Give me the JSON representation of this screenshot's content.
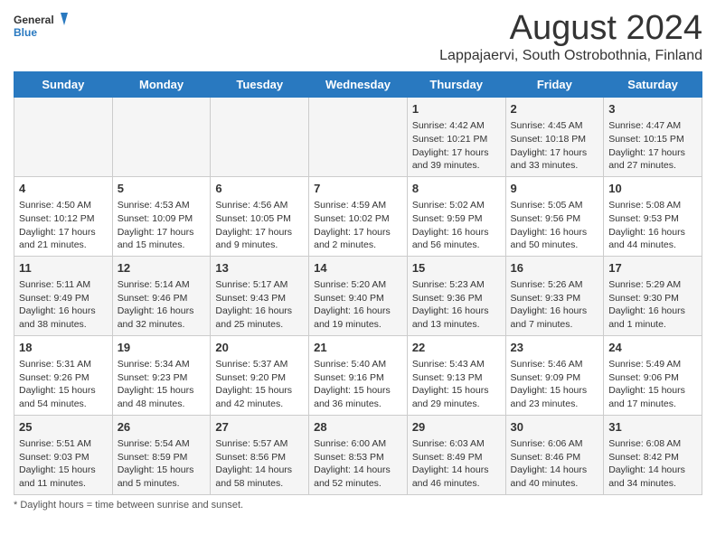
{
  "header": {
    "logo_line1": "General",
    "logo_line2": "Blue",
    "main_title": "August 2024",
    "subtitle": "Lappajaervi, South Ostrobothnia, Finland"
  },
  "footer": {
    "note": "Daylight hours"
  },
  "columns": [
    "Sunday",
    "Monday",
    "Tuesday",
    "Wednesday",
    "Thursday",
    "Friday",
    "Saturday"
  ],
  "weeks": [
    [
      {
        "day": "",
        "info": ""
      },
      {
        "day": "",
        "info": ""
      },
      {
        "day": "",
        "info": ""
      },
      {
        "day": "",
        "info": ""
      },
      {
        "day": "1",
        "info": "Sunrise: 4:42 AM\nSunset: 10:21 PM\nDaylight: 17 hours\nand 39 minutes."
      },
      {
        "day": "2",
        "info": "Sunrise: 4:45 AM\nSunset: 10:18 PM\nDaylight: 17 hours\nand 33 minutes."
      },
      {
        "day": "3",
        "info": "Sunrise: 4:47 AM\nSunset: 10:15 PM\nDaylight: 17 hours\nand 27 minutes."
      }
    ],
    [
      {
        "day": "4",
        "info": "Sunrise: 4:50 AM\nSunset: 10:12 PM\nDaylight: 17 hours\nand 21 minutes."
      },
      {
        "day": "5",
        "info": "Sunrise: 4:53 AM\nSunset: 10:09 PM\nDaylight: 17 hours\nand 15 minutes."
      },
      {
        "day": "6",
        "info": "Sunrise: 4:56 AM\nSunset: 10:05 PM\nDaylight: 17 hours\nand 9 minutes."
      },
      {
        "day": "7",
        "info": "Sunrise: 4:59 AM\nSunset: 10:02 PM\nDaylight: 17 hours\nand 2 minutes."
      },
      {
        "day": "8",
        "info": "Sunrise: 5:02 AM\nSunset: 9:59 PM\nDaylight: 16 hours\nand 56 minutes."
      },
      {
        "day": "9",
        "info": "Sunrise: 5:05 AM\nSunset: 9:56 PM\nDaylight: 16 hours\nand 50 minutes."
      },
      {
        "day": "10",
        "info": "Sunrise: 5:08 AM\nSunset: 9:53 PM\nDaylight: 16 hours\nand 44 minutes."
      }
    ],
    [
      {
        "day": "11",
        "info": "Sunrise: 5:11 AM\nSunset: 9:49 PM\nDaylight: 16 hours\nand 38 minutes."
      },
      {
        "day": "12",
        "info": "Sunrise: 5:14 AM\nSunset: 9:46 PM\nDaylight: 16 hours\nand 32 minutes."
      },
      {
        "day": "13",
        "info": "Sunrise: 5:17 AM\nSunset: 9:43 PM\nDaylight: 16 hours\nand 25 minutes."
      },
      {
        "day": "14",
        "info": "Sunrise: 5:20 AM\nSunset: 9:40 PM\nDaylight: 16 hours\nand 19 minutes."
      },
      {
        "day": "15",
        "info": "Sunrise: 5:23 AM\nSunset: 9:36 PM\nDaylight: 16 hours\nand 13 minutes."
      },
      {
        "day": "16",
        "info": "Sunrise: 5:26 AM\nSunset: 9:33 PM\nDaylight: 16 hours\nand 7 minutes."
      },
      {
        "day": "17",
        "info": "Sunrise: 5:29 AM\nSunset: 9:30 PM\nDaylight: 16 hours\nand 1 minute."
      }
    ],
    [
      {
        "day": "18",
        "info": "Sunrise: 5:31 AM\nSunset: 9:26 PM\nDaylight: 15 hours\nand 54 minutes."
      },
      {
        "day": "19",
        "info": "Sunrise: 5:34 AM\nSunset: 9:23 PM\nDaylight: 15 hours\nand 48 minutes."
      },
      {
        "day": "20",
        "info": "Sunrise: 5:37 AM\nSunset: 9:20 PM\nDaylight: 15 hours\nand 42 minutes."
      },
      {
        "day": "21",
        "info": "Sunrise: 5:40 AM\nSunset: 9:16 PM\nDaylight: 15 hours\nand 36 minutes."
      },
      {
        "day": "22",
        "info": "Sunrise: 5:43 AM\nSunset: 9:13 PM\nDaylight: 15 hours\nand 29 minutes."
      },
      {
        "day": "23",
        "info": "Sunrise: 5:46 AM\nSunset: 9:09 PM\nDaylight: 15 hours\nand 23 minutes."
      },
      {
        "day": "24",
        "info": "Sunrise: 5:49 AM\nSunset: 9:06 PM\nDaylight: 15 hours\nand 17 minutes."
      }
    ],
    [
      {
        "day": "25",
        "info": "Sunrise: 5:51 AM\nSunset: 9:03 PM\nDaylight: 15 hours\nand 11 minutes."
      },
      {
        "day": "26",
        "info": "Sunrise: 5:54 AM\nSunset: 8:59 PM\nDaylight: 15 hours\nand 5 minutes."
      },
      {
        "day": "27",
        "info": "Sunrise: 5:57 AM\nSunset: 8:56 PM\nDaylight: 14 hours\nand 58 minutes."
      },
      {
        "day": "28",
        "info": "Sunrise: 6:00 AM\nSunset: 8:53 PM\nDaylight: 14 hours\nand 52 minutes."
      },
      {
        "day": "29",
        "info": "Sunrise: 6:03 AM\nSunset: 8:49 PM\nDaylight: 14 hours\nand 46 minutes."
      },
      {
        "day": "30",
        "info": "Sunrise: 6:06 AM\nSunset: 8:46 PM\nDaylight: 14 hours\nand 40 minutes."
      },
      {
        "day": "31",
        "info": "Sunrise: 6:08 AM\nSunset: 8:42 PM\nDaylight: 14 hours\nand 34 minutes."
      }
    ]
  ]
}
